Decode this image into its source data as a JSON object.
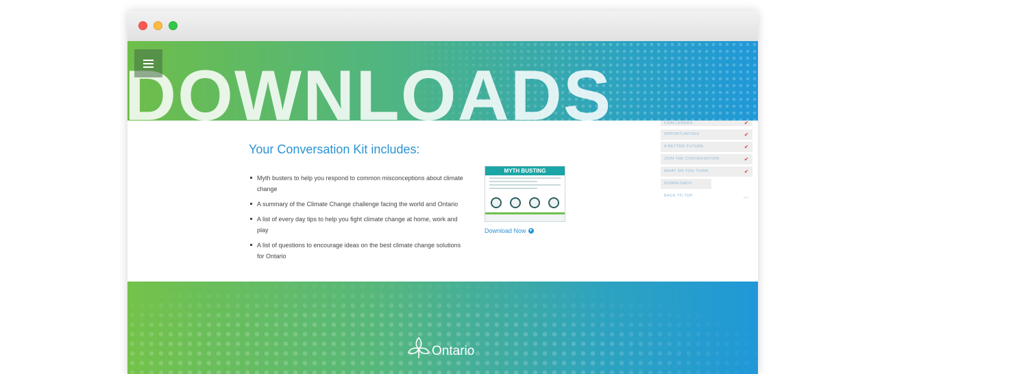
{
  "window": {
    "controls": [
      "close",
      "minimize",
      "maximize"
    ]
  },
  "hero": {
    "title": "DOWNLOADS",
    "menu_icon": "hamburger-icon"
  },
  "kit": {
    "heading": "Your Conversation Kit includes:",
    "items": [
      "Myth busters to help you respond to common misconceptions about climate change",
      "A summary of the Climate Change challenge facing the world and Ontario",
      "A list of every day tips to help you fight climate change at home, work and play",
      "A list of questions to encourage ideas on the best climate change solutions for Ontario"
    ]
  },
  "thumbnail": {
    "title": "MYTH BUSTING"
  },
  "download": {
    "label": "Download Now",
    "icon": "chevron-circle-down-icon"
  },
  "sidenav": {
    "items": [
      {
        "label": "CHALLENGES",
        "completed": true
      },
      {
        "label": "OPPORTUNITIES",
        "completed": true
      },
      {
        "label": "A BETTER FUTURE",
        "completed": true
      },
      {
        "label": "JOIN THE CONVERSATION",
        "completed": true
      },
      {
        "label": "WHAT DO YOU THINK",
        "completed": true
      },
      {
        "label": "DOWNLOADS",
        "completed": false,
        "current": true
      }
    ],
    "back_to_top": "BACK TO TOP",
    "check_symbol": "✔",
    "up_symbol": "︿"
  },
  "footer": {
    "logo_text": "Ontario",
    "logo_icon": "trillium-icon"
  },
  "colors": {
    "accent_blue": "#2a93d5",
    "check_red": "#e0483e",
    "gradient_green": "#6fbe4a",
    "gradient_blue": "#1f98d8"
  }
}
